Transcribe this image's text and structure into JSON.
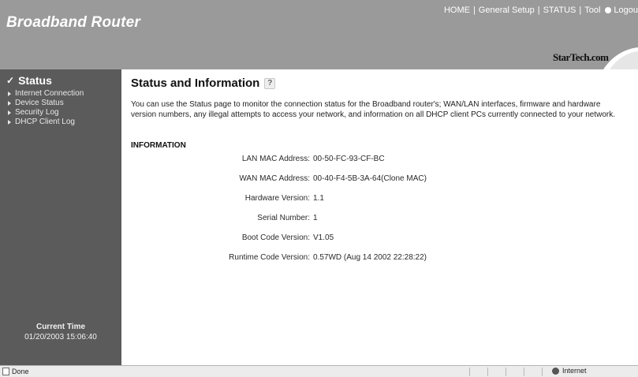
{
  "header": {
    "brand": "Broadband Router",
    "nav": {
      "home": "HOME",
      "general_setup": "General Setup",
      "status": "STATUS",
      "tool": "Tool",
      "logout": "Logou"
    },
    "separator": "|",
    "logo_text": "StarTech.com"
  },
  "sidebar": {
    "heading_icon": "checkmark-icon",
    "heading": "Status",
    "items": [
      {
        "label": "Internet Connection"
      },
      {
        "label": "Device Status"
      },
      {
        "label": "Security Log"
      },
      {
        "label": "DHCP Client Log"
      }
    ],
    "time_label": "Current Time",
    "time_value": "01/20/2003 15:06:40"
  },
  "main": {
    "title": "Status and Information",
    "help_icon": "help-icon",
    "description": "You can use the Status page to monitor the connection status for the Broadband router's; WAN/LAN interfaces, firmware and hardware version numbers, any illegal attempts to access your network, and information on all DHCP client PCs currently connected to your network.",
    "section": "INFORMATION",
    "info": [
      {
        "label": "LAN MAC Address:",
        "value": "00-50-FC-93-CF-BC"
      },
      {
        "label": "WAN MAC Address:",
        "value": "00-40-F4-5B-3A-64(Clone MAC)"
      },
      {
        "label": "Hardware Version:",
        "value": "1.1"
      },
      {
        "label": "Serial Number:",
        "value": "1"
      },
      {
        "label": "Boot Code Version:",
        "value": "V1.05"
      },
      {
        "label": "Runtime Code Version:",
        "value": "0.57WD (Aug 14 2002 22:28:22)"
      }
    ]
  },
  "statusbar": {
    "done": "Done",
    "zone": "Internet"
  },
  "colors": {
    "header_bg": "#9a9a9a",
    "sidebar_bg": "#5b5b5b",
    "main_bg": "#ffffff"
  }
}
